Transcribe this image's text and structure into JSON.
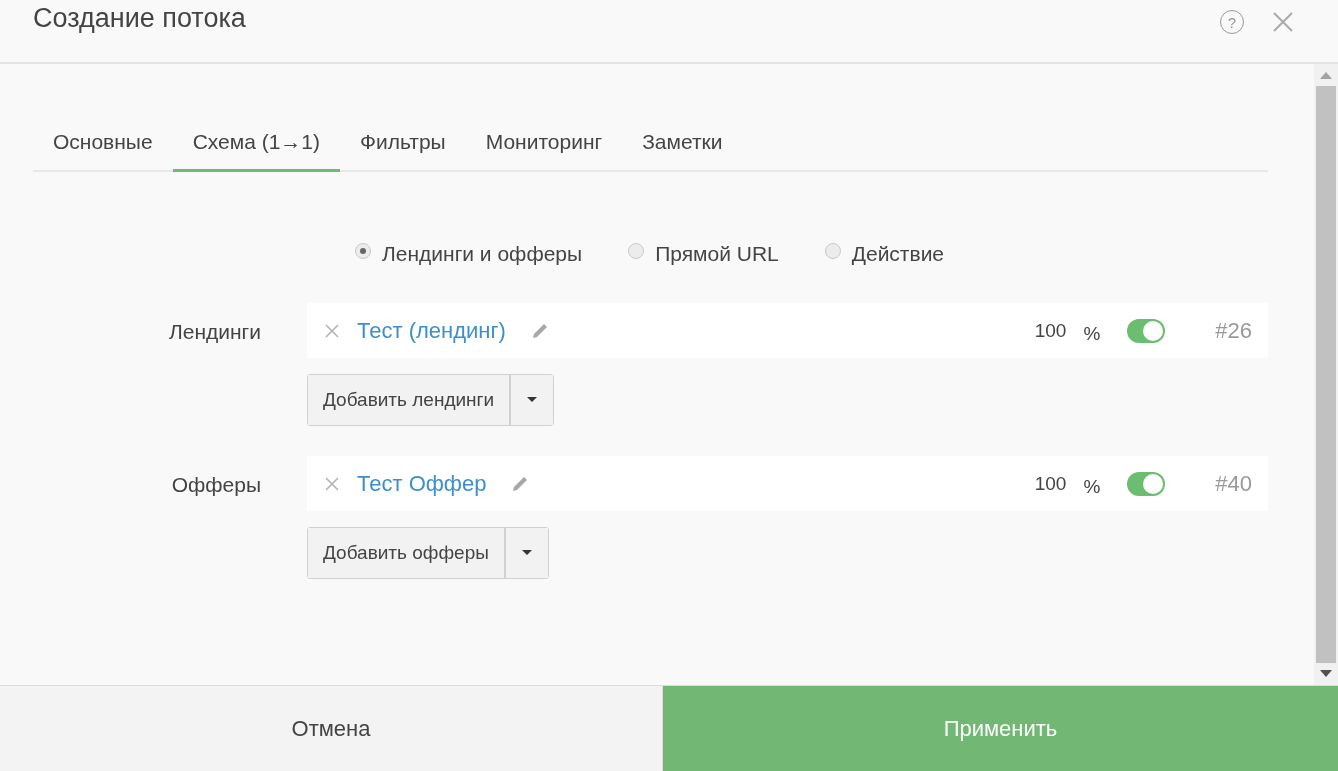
{
  "window": {
    "title": "Создание потока",
    "help": "?"
  },
  "tabs": [
    {
      "label": "Основные",
      "selected": false
    },
    {
      "label": "Схема (1→1)",
      "selected": true
    },
    {
      "label": "Фильтры",
      "selected": false
    },
    {
      "label": "Мониторинг",
      "selected": false
    },
    {
      "label": "Заметки",
      "selected": false
    }
  ],
  "scheme_options": [
    {
      "label": "Лендинги и офферы",
      "selected": true
    },
    {
      "label": "Прямой URL",
      "selected": false
    },
    {
      "label": "Действие",
      "selected": false
    }
  ],
  "sections": [
    {
      "label": "Лендинги",
      "items": [
        {
          "name": "Тест (лендинг)",
          "weight": "100",
          "unit": "%",
          "on": true,
          "id": "#26"
        }
      ],
      "add_button": "Добавить лендинги"
    },
    {
      "label": "Офферы",
      "items": [
        {
          "name": "Тест Оффер",
          "weight": "100",
          "unit": "%",
          "on": true,
          "id": "#40"
        }
      ],
      "add_button": "Добавить офферы"
    }
  ],
  "footer": {
    "cancel": "Отмена",
    "apply": "Применить"
  }
}
